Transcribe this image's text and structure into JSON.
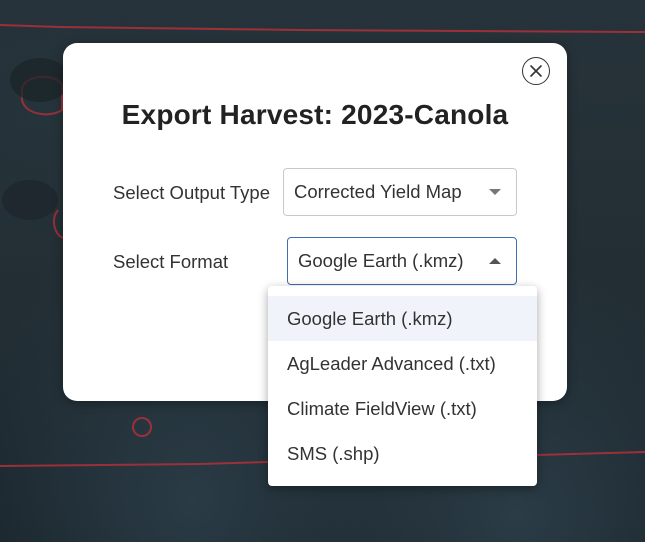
{
  "modal": {
    "title": "Export Harvest: 2023-Canola",
    "close_icon": "close-circle-icon"
  },
  "output_type": {
    "label": "Select Output Type",
    "value": "Corrected Yield Map"
  },
  "format": {
    "label": "Select Format",
    "value": "Google Earth (.kmz)",
    "options": [
      "Google Earth (.kmz)",
      "AgLeader Advanced (.txt)",
      "Climate FieldView (.txt)",
      "SMS (.shp)"
    ],
    "selected_index": 0
  },
  "colors": {
    "accent_border": "#3e6fb0",
    "field_boundary": "#b0303a",
    "selected_option_bg": "#f0f3f9"
  }
}
